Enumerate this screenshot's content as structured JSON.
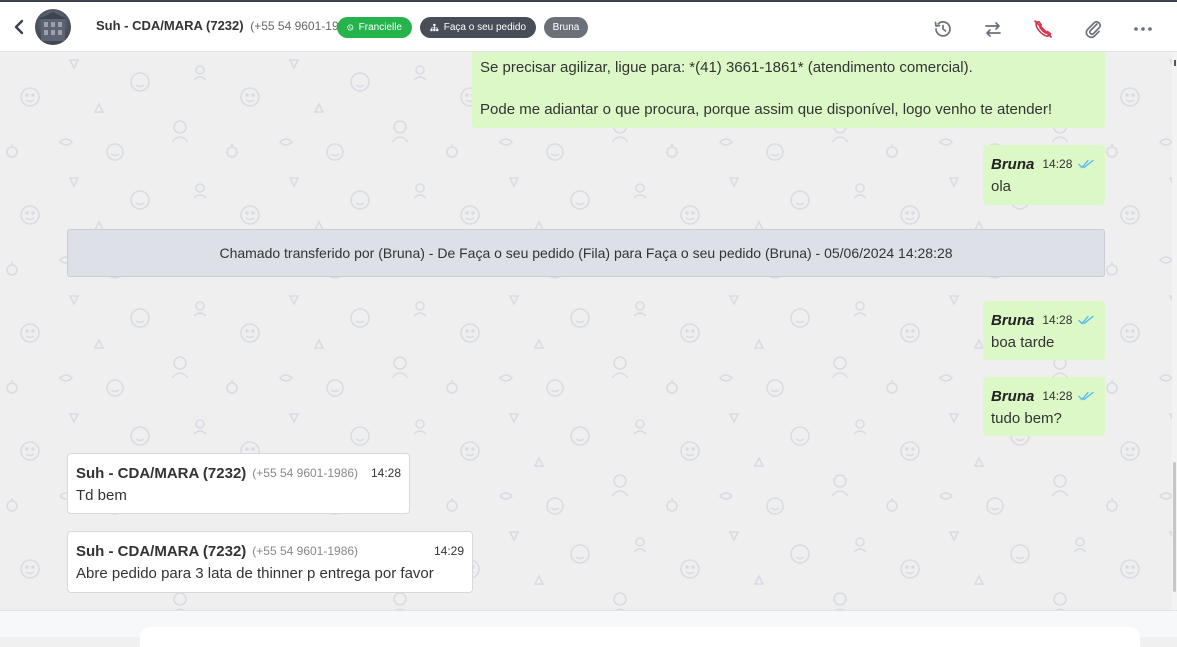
{
  "header": {
    "contact_name": "Suh - CDA/MARA (7232)",
    "contact_phone": "(+55 54 9601-1986)",
    "tags": [
      {
        "label": "Francielle",
        "color": "#25b34b",
        "icon": "whatsapp-icon"
      },
      {
        "label": "Faça o seu pedido",
        "color": "#484e57",
        "icon": "sitemap-icon"
      },
      {
        "label": "Bruna",
        "color": "#6b7079"
      }
    ],
    "actions": [
      "history-icon",
      "transfer-icon",
      "end-call-icon",
      "paperclip-icon",
      "more-icon"
    ]
  },
  "messages": {
    "m0": {
      "line1": "Se precisar agilizar, ligue para: *(41) 3661-1861* (atendimento comercial).",
      "line2": "Pode me adiantar o que procura, porque assim que disponível, logo venho te atender!"
    },
    "m1": {
      "sender": "Bruna",
      "time": "14:28",
      "text": "ola"
    },
    "system": "Chamado transferido por (Bruna) - De Faça o seu pedido (Fila) para Faça o seu pedido (Bruna) - 05/06/2024 14:28:28",
    "m2": {
      "sender": "Bruna",
      "time": "14:28",
      "text": "boa tarde"
    },
    "m3": {
      "sender": "Bruna",
      "time": "14:28",
      "text": "tudo bem?"
    },
    "m4": {
      "sender": "Suh - CDA/MARA (7232)",
      "phone": "(+55 54 9601-1986)",
      "time": "14:28",
      "text": "Td bem"
    },
    "m5": {
      "sender": "Suh - CDA/MARA (7232)",
      "phone": "(+55 54 9601-1986)",
      "time": "14:29",
      "text": "Abre pedido para 3 lata de thinner p entrega por favor"
    }
  },
  "colors": {
    "outgoing": "#dcf8c6",
    "incoming": "#ffffff",
    "system": "#dde0e7",
    "read_ticks": "#4fb6ec",
    "end_call": "#d8324a"
  }
}
